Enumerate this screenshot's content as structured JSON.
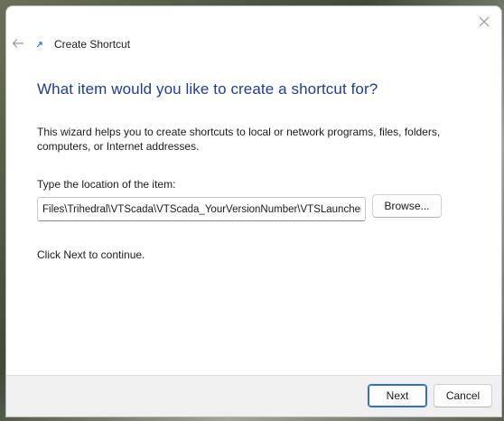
{
  "window": {
    "title": "Create Shortcut"
  },
  "icons": {
    "close": "close-icon",
    "back": "back-arrow-icon",
    "shortcut": "shortcut-arrow-icon"
  },
  "wizard": {
    "heading": "What item would you like to create a shortcut for?",
    "description": "This wizard helps you to create shortcuts to local or network programs, files, folders, computers, or Internet addresses.",
    "location_label": "Type the location of the item:",
    "location_value": "Files\\Trihedral\\VTScada\\VTScada_YourVersionNumber\\VTSLauncher.exe\"",
    "browse_label": "Browse...",
    "continue_text": "Click Next to continue."
  },
  "footer": {
    "next_label": "Next",
    "cancel_label": "Cancel"
  },
  "colors": {
    "heading": "#1e3d9a",
    "accent": "#2f6fd1"
  }
}
